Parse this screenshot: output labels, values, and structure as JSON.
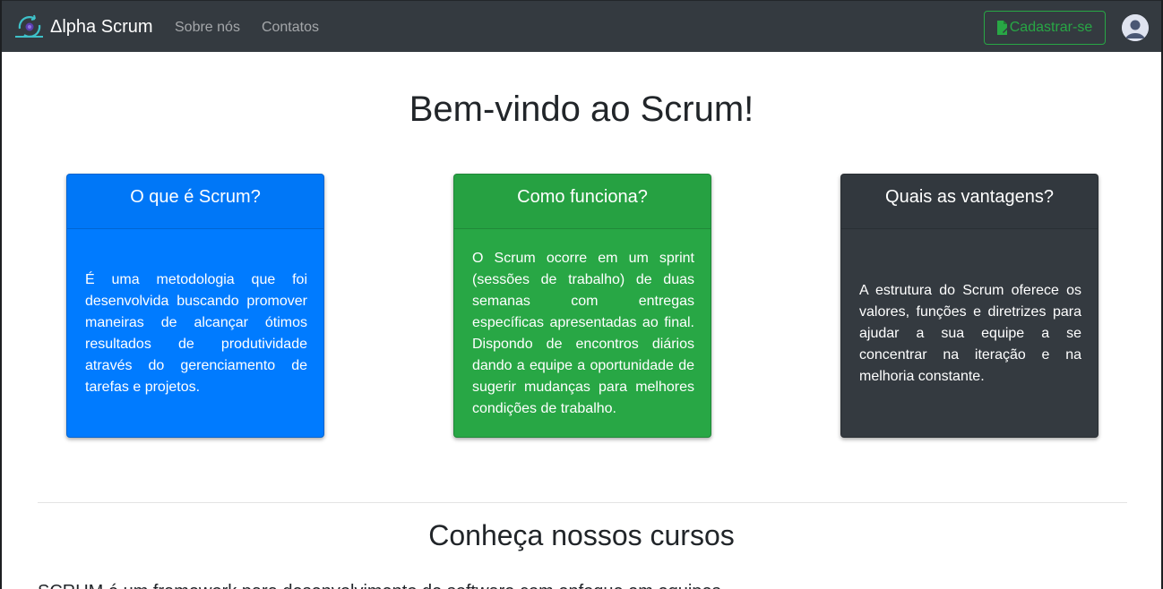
{
  "navbar": {
    "brand": "Δlpha Scrum",
    "links": [
      {
        "label": "Sobre nós"
      },
      {
        "label": "Contatos"
      }
    ],
    "signup_label": "Cadastrar-se"
  },
  "hero": {
    "title": "Bem-vindo ao Scrum!"
  },
  "cards": [
    {
      "title": "O que é Scrum?",
      "text": "É uma metodologia que foi desenvolvida buscando promover maneiras de alcançar ótimos resultados de produtividade através do gerenciamento de tarefas e projetos."
    },
    {
      "title": "Como funciona?",
      "text": "O Scrum ocorre em um sprint (sessões de trabalho) de duas semanas com entregas específicas apresentadas ao final. Dispondo de encontros diários dando a equipe a oportunidade de sugerir mudanças para melhores condições de trabalho."
    },
    {
      "title": "Quais as vantagens?",
      "text": "A estrutura do Scrum oferece os valores, funções e diretrizes para ajudar a sua equipe a se concentrar na iteração e na melhoria constante."
    }
  ],
  "courses": {
    "title": "Conheça nossos cursos",
    "text_partial": "SCRUM é um framework para desenvolvimento de software com enfoque em equipes"
  },
  "colors": {
    "navbar": "#343a40",
    "primary": "#007bff",
    "success": "#28a745",
    "dark": "#343a40"
  },
  "icons": {
    "brand": "scrum-cycle-logo-icon",
    "signup": "file-signature-icon",
    "avatar": "user-avatar-icon"
  }
}
